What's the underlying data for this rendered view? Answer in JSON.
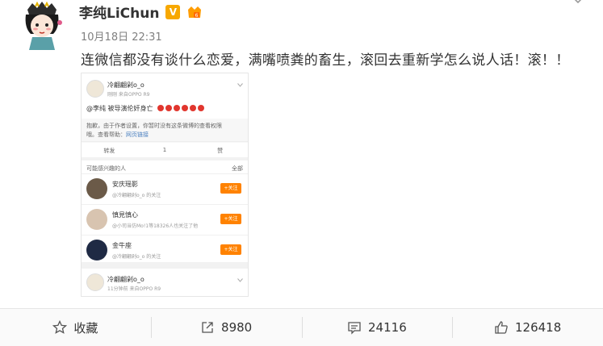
{
  "post": {
    "author": "李纯LiChun",
    "timestamp": "10月18日 22:31",
    "text": "连微信都没有谈什么恋爱，满嘴喷粪的畜生，滚回去重新学怎么说人话！滚！！"
  },
  "embedded": {
    "top_user": "冷翩翩剁ο_ο",
    "top_sub": "刚刚  来自OPPO R9",
    "mention_text": "@李纯  被导演伦奸身亡",
    "notice_line1": "抱歉，由于作者设置，你暂时没有这条微博的查看权限",
    "notice_line2": "哦。查看帮助：",
    "notice_link": "网页链接",
    "actions": [
      "转发",
      "1",
      "赞"
    ],
    "rec_header": "可能感兴趣的人",
    "rec_all": "全部",
    "recommendations": [
      {
        "name": "安庆瑶影",
        "sub": "@冷翩翩剁ο_ο 的关注",
        "btn": "+关注"
      },
      {
        "name": "慎見慎心",
        "sub": "@小司当仿Mo!1等18326人也关注了他",
        "btn": "+关注"
      },
      {
        "name": "金牛座",
        "sub": "@冷翩翩剁ο_ο 的关注",
        "btn": "+关注"
      }
    ],
    "bottom_user": "冷翩翩剁ο_ο",
    "bottom_sub": "11分钟前  来自OPPO R9"
  },
  "footer": {
    "favorite": "收藏",
    "repost": "8980",
    "comment": "24116",
    "like": "126418"
  },
  "icons": [
    "avatar-illustration",
    "verified-v-icon",
    "level-crown-icon",
    "chevron-down-icon",
    "star-icon",
    "share-icon",
    "comment-icon",
    "thumbs-up-icon"
  ],
  "colors": {
    "verified": "#f7a800",
    "follow": "#ff8200",
    "link": "#4a7fbf"
  }
}
